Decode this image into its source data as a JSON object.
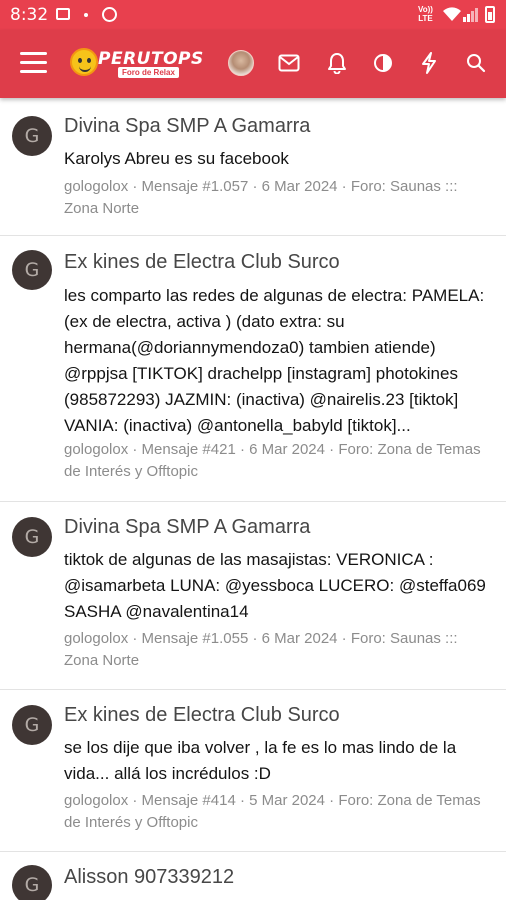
{
  "status_bar": {
    "time": "8:32",
    "network_top": "Vo))",
    "network_bottom": "LTE"
  },
  "app": {
    "logo_text": "PERUTOPS",
    "logo_subtitle": "Foro de Relax",
    "icons": [
      "menu-icon",
      "avatar",
      "mail-icon",
      "bell-icon",
      "theme-icon",
      "flash-icon",
      "search-icon"
    ],
    "accent_color": "#de3d4a"
  },
  "results": [
    {
      "initial": "G",
      "title": "Divina Spa SMP A Gamarra",
      "snippet": "Karolys Abreu es su facebook",
      "meta": "gologolox · Mensaje #1.057 · 6 Mar 2024 · Foro: Saunas ::: Zona Norte"
    },
    {
      "initial": "G",
      "title": "Ex kines de Electra Club Surco",
      "snippet": "les comparto las redes de algunas de electra: PAMELA: (ex de electra, activa ) (dato extra: su hermana(@doriannymendoza0) tambien atiende) @rppjsa [TIKTOK] drachelpp [instagram] photokines (985872293) JAZMIN: (inactiva) @nairelis.23 [tiktok] VANIA: (inactiva) @antonella_babyld [tiktok]...",
      "meta": "gologolox · Mensaje #421 · 6 Mar 2024 · Foro: Zona de Temas de Interés y Offtopic"
    },
    {
      "initial": "G",
      "title": "Divina Spa SMP A Gamarra",
      "snippet": "tiktok de algunas de las masajistas: VERONICA : @isamarbeta LUNA: @yessboca LUCERO: @steffa069 SASHA @navalentina14",
      "meta": "gologolox · Mensaje #1.055 · 6 Mar 2024 · Foro: Saunas ::: Zona Norte"
    },
    {
      "initial": "G",
      "title": "Ex kines de Electra Club Surco",
      "snippet": "se los dije que iba volver , la fe es lo mas lindo de la vida... allá los incrédulos :D",
      "meta": "gologolox · Mensaje #414 · 5 Mar 2024 · Foro: Zona de Temas de Interés y Offtopic"
    },
    {
      "initial": "G",
      "title": "Alisson 907339212",
      "snippet": "",
      "meta": ""
    }
  ]
}
